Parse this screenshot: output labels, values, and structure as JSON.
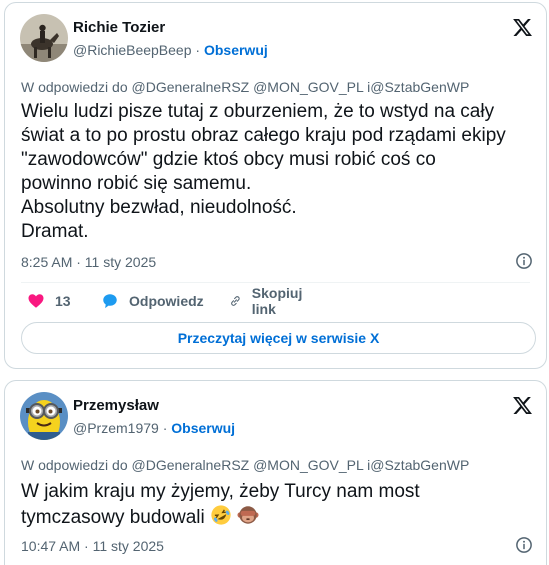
{
  "tweets": [
    {
      "author_name": "Richie Tozier",
      "handle": "@RichieBeepBeep",
      "separator": "·",
      "follow_label": "Obserwuj",
      "reply_to": "W odpowiedzi do @DGeneralneRSZ @MON_GOV_PL i@SztabGenWP",
      "body_lines": [
        "Wielu ludzi pisze tutaj z oburzeniem, że to wstyd na cały",
        "świat a to po prostu obraz całego kraju pod rządami ekipy",
        "\"zawodowców\" gdzie ktoś obcy musi robić coś co",
        "powinno robić się samemu.",
        "Absolutny bezwład, nieudolność.",
        "Dramat."
      ],
      "timestamp": "8:25 AM · 11 sty 2025",
      "likes": "13",
      "reply_label": "Odpowiedz",
      "copy_label": "Skopiuj link",
      "read_more_label": "Przeczytaj więcej w serwisie X"
    },
    {
      "author_name": "Przemysław",
      "handle": "@Przem1979",
      "separator": "·",
      "follow_label": "Obserwuj",
      "reply_to": "W odpowiedzi do @DGeneralneRSZ @MON_GOV_PL i@SztabGenWP",
      "body_lines": [
        "W jakim kraju my żyjemy, żeby Turcy nam most",
        "tymczasowy budowali"
      ],
      "emojis": [
        "rolling-on-floor-laughing-emoji",
        "see-no-evil-monkey-emoji"
      ],
      "timestamp": "10:47 AM · 11 sty 2025"
    }
  ],
  "colors": {
    "text": "#0f1419",
    "secondary": "#536471",
    "link": "#006fd6",
    "like": "#f91880",
    "border": "#cfd9de"
  }
}
